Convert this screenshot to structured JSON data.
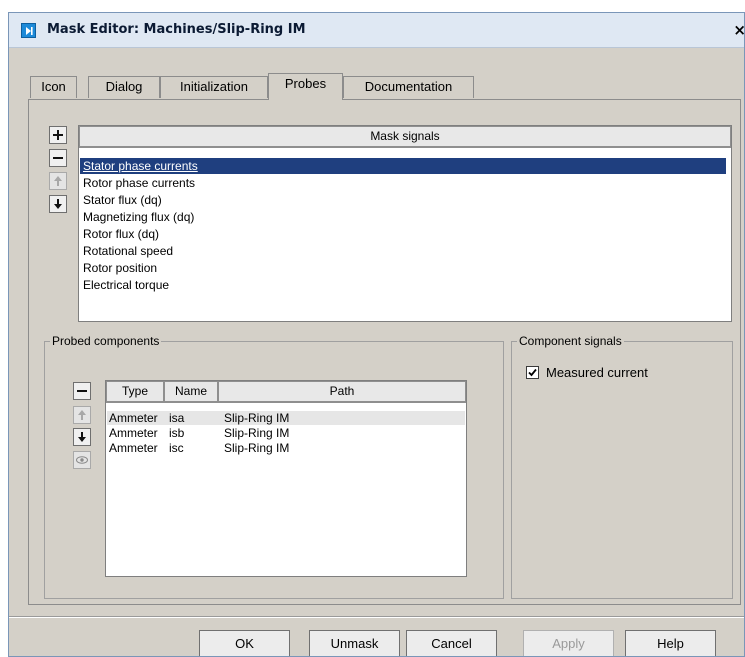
{
  "window": {
    "title": "Mask Editor: Machines/Slip-Ring IM",
    "close_glyph": "×",
    "app_icon": "play-icon"
  },
  "tabs": [
    {
      "label": "Icon"
    },
    {
      "label": "Dialog"
    },
    {
      "label": "Initialization"
    },
    {
      "label": "Probes",
      "active": true
    },
    {
      "label": "Documentation"
    }
  ],
  "mask_signals": {
    "header": "Mask signals",
    "items": [
      "Stator phase currents",
      "Rotor phase currents",
      "Stator flux (dq)",
      "Magnetizing flux (dq)",
      "Rotor flux (dq)",
      "Rotational speed",
      "Rotor position",
      "Electrical torque"
    ],
    "selected_index": 0,
    "buttons": [
      "add-icon",
      "remove-icon",
      "move-up-icon",
      "move-down-icon"
    ]
  },
  "probed_components": {
    "label": "Probed components",
    "columns": [
      "Type",
      "Name",
      "Path"
    ],
    "rows": [
      {
        "type": "Ammeter",
        "name": "isa",
        "path": "Slip-Ring IM"
      },
      {
        "type": "Ammeter",
        "name": "isb",
        "path": "Slip-Ring IM"
      },
      {
        "type": "Ammeter",
        "name": "isc",
        "path": "Slip-Ring IM"
      }
    ],
    "selected_index": 0,
    "buttons": [
      "remove-icon",
      "move-up-icon",
      "move-down-icon",
      "eye-icon"
    ]
  },
  "component_signals": {
    "label": "Component signals",
    "items": [
      {
        "label": "Measured current",
        "checked": true
      }
    ]
  },
  "buttons": {
    "ok": "OK",
    "unmask": "Unmask",
    "cancel": "Cancel",
    "apply": "Apply",
    "help": "Help"
  },
  "colors": {
    "selection": "#1f3f7f",
    "dialog_bg": "#d4d0c8",
    "titlebar": "#dfe8f3",
    "icon_blue": "#1d8ad8"
  }
}
